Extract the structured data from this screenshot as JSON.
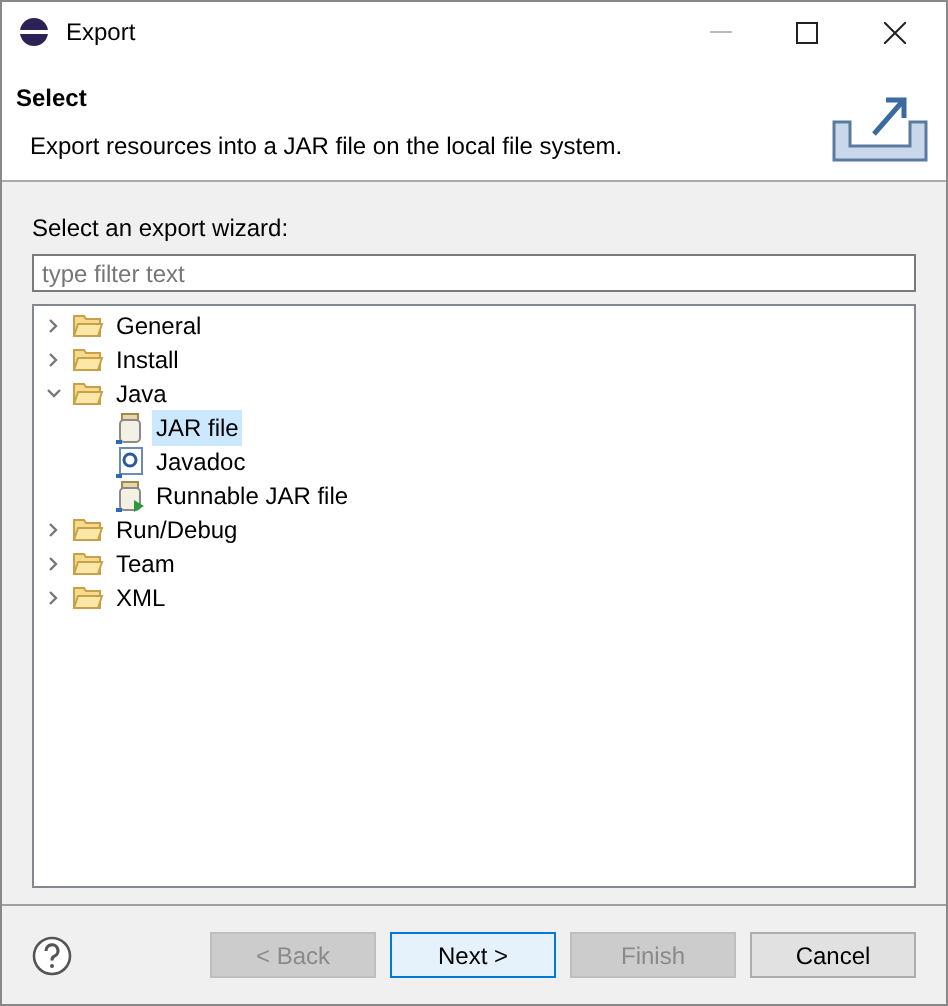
{
  "window": {
    "title": "Export"
  },
  "header": {
    "title": "Select",
    "description": "Export resources into a JAR file on the local file system."
  },
  "wizard_label": "Select an export wizard:",
  "filter": {
    "placeholder": "type filter text"
  },
  "tree": [
    {
      "label": "General",
      "kind": "folder",
      "expanded": false,
      "selected": false
    },
    {
      "label": "Install",
      "kind": "folder",
      "expanded": false,
      "selected": false
    },
    {
      "label": "Java",
      "kind": "folder",
      "expanded": true,
      "selected": false,
      "children": [
        {
          "label": "JAR file",
          "kind": "jar",
          "selected": true
        },
        {
          "label": "Javadoc",
          "kind": "javadoc",
          "selected": false
        },
        {
          "label": "Runnable JAR file",
          "kind": "runnable",
          "selected": false
        }
      ]
    },
    {
      "label": "Run/Debug",
      "kind": "folder",
      "expanded": false,
      "selected": false
    },
    {
      "label": "Team",
      "kind": "folder",
      "expanded": false,
      "selected": false
    },
    {
      "label": "XML",
      "kind": "folder",
      "expanded": false,
      "selected": false
    }
  ],
  "buttons": [
    {
      "label": "< Back",
      "disabled": true,
      "focused": false
    },
    {
      "label": "Next >",
      "disabled": false,
      "focused": true
    },
    {
      "label": "Finish",
      "disabled": true,
      "focused": false
    },
    {
      "label": "Cancel",
      "disabled": false,
      "focused": false
    }
  ]
}
